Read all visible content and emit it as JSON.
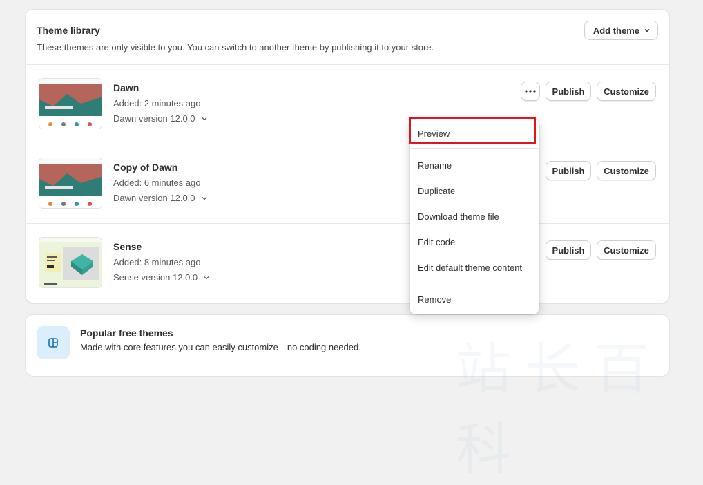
{
  "library": {
    "title": "Theme library",
    "subtitle": "These themes are only visible to you. You can switch to another theme by publishing it to your store.",
    "add_theme_label": "Add theme"
  },
  "themes": [
    {
      "name": "Dawn",
      "added": "Added: 2 minutes ago",
      "version": "Dawn version 12.0.0",
      "publish_label": "Publish",
      "customize_label": "Customize"
    },
    {
      "name": "Copy of Dawn",
      "added": "Added: 6 minutes ago",
      "version": "Dawn version 12.0.0",
      "publish_label": "Publish",
      "customize_label": "Customize"
    },
    {
      "name": "Sense",
      "added": "Added: 8 minutes ago",
      "version": "Sense version 12.0.0",
      "publish_label": "Publish",
      "customize_label": "Customize"
    }
  ],
  "actions_menu": {
    "items": [
      "Preview",
      "Rename",
      "Duplicate",
      "Download theme file",
      "Edit code",
      "Edit default theme content",
      "Remove"
    ],
    "highlighted": "Preview"
  },
  "popular": {
    "title": "Popular free themes",
    "subtitle": "Made with core features you can easily customize—no coding needed."
  },
  "colors": {
    "highlight": "#e0151d",
    "icon_bg": "#dbeefb",
    "icon_fg": "#1b6fb3"
  },
  "icons": [
    "chevron-down-icon",
    "more-horizontal-icon",
    "theme-icon"
  ]
}
